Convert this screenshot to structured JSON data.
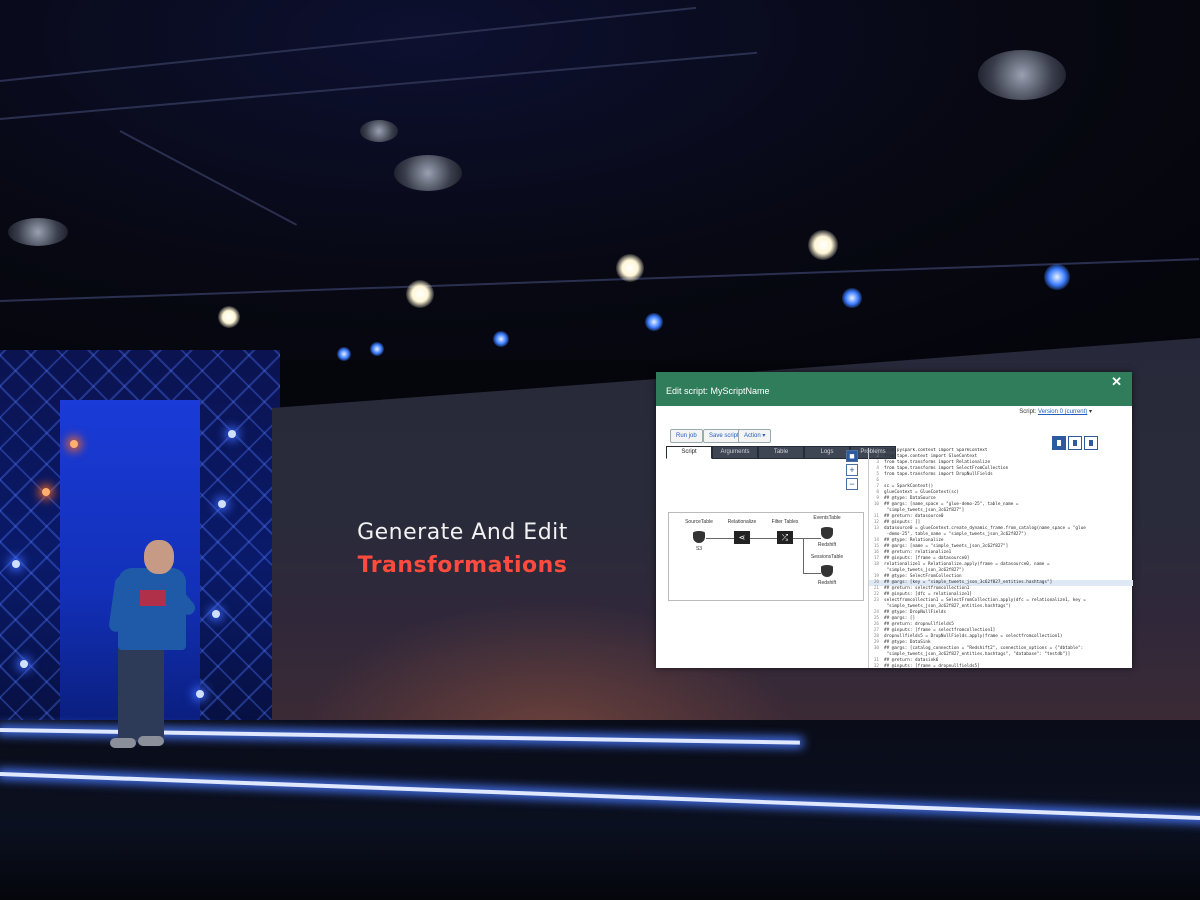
{
  "slide": {
    "line1": "Generate And Edit",
    "line2": "Transformations",
    "line2_color": "#ff4b3e"
  },
  "console": {
    "title": "Edit script: MyScriptName",
    "close_icon": "close-icon",
    "script_label": "Script:",
    "script_version": "Version 0 (current)",
    "buttons": {
      "run": "Run job",
      "save": "Save script",
      "action": "Action ▾"
    },
    "tabs": [
      "Script",
      "Arguments",
      "Table",
      "Logs",
      "Problems"
    ],
    "active_tab": "Script",
    "title_bar_color": "#2f7d5a",
    "graph": {
      "nodes": [
        "SourceTable",
        "Relationalize",
        "Filter Tables",
        "EventsTable",
        "SessionsTable"
      ],
      "db_labels": [
        "S3",
        "Redshift",
        "Redshift"
      ]
    },
    "code_lines": [
      {
        "n": "1",
        "t": "from pyspark.context import SparkContext"
      },
      {
        "n": "2",
        "t": "from tape.context import GlueContext"
      },
      {
        "n": "3",
        "t": "from tape.transforms import Relationalize"
      },
      {
        "n": "4",
        "t": "from tape.transforms import SelectFromCollection"
      },
      {
        "n": "5",
        "t": "from tape.transforms import DropNullFields"
      },
      {
        "n": "6",
        "t": ""
      },
      {
        "n": "7",
        "t": "sc = SparkContext()"
      },
      {
        "n": "8",
        "t": "glueContext = GlueContext(sc)"
      },
      {
        "n": "9",
        "t": "## @type: DataSource"
      },
      {
        "n": "10",
        "t": "## @args: [name_space = \"glue-demo-25\", table_name ="
      },
      {
        "n": "",
        "t": "    \"simple_tweets_json_3c62f827\"]"
      },
      {
        "n": "11",
        "t": "## @return: datasource0"
      },
      {
        "n": "12",
        "t": "## @inputs: []"
      },
      {
        "n": "13",
        "t": "datasource0 = glueContext.create_dynamic_frame.from_catalog(name_space = \"glue"
      },
      {
        "n": "",
        "t": "    -demo-25\", table_name = \"simple_tweets_json_3c62f827\")"
      },
      {
        "n": "14",
        "t": "## @type: Relationalize"
      },
      {
        "n": "15",
        "t": "## @args: [name = \"simple_tweets_json_3c62f827\"]"
      },
      {
        "n": "16",
        "t": "## @return: relationalize1"
      },
      {
        "n": "17",
        "t": "## @inputs: [frame = datasource0]"
      },
      {
        "n": "18",
        "t": "relationalize1 = Relationalize.apply(frame = datasource0, name ="
      },
      {
        "n": "",
        "t": "    \"simple_tweets_json_3c62f827\")"
      },
      {
        "n": "19",
        "t": "## @type: SelectFromCollection"
      },
      {
        "n": "20",
        "t": "## @args: [key = \"simple_tweets_json_3c62f827_entities.hashtags\"]"
      },
      {
        "n": "21",
        "t": "## @return: selectfromcollection1"
      },
      {
        "n": "22",
        "t": "## @inputs: [dfc = relationalize1]"
      },
      {
        "n": "23",
        "t": "selectfromcollection1 = SelectFromCollection.apply(dfc = relationalize1, key ="
      },
      {
        "n": "",
        "t": "    \"simple_tweets_json_3c62f827_entities.hashtags\")"
      },
      {
        "n": "24",
        "t": "## @type: DropNullFields"
      },
      {
        "n": "25",
        "t": "## @args: []"
      },
      {
        "n": "26",
        "t": "## @return: dropnullfields5"
      },
      {
        "n": "27",
        "t": "## @inputs: [frame = selectfromcollection1]"
      },
      {
        "n": "28",
        "t": "dropnullfields5 = DropNullFields.apply(frame = selectfromcollection1)"
      },
      {
        "n": "29",
        "t": "## @type: DataSink"
      },
      {
        "n": "30",
        "t": "## @args: [catalog_connection = \"Redshift2\", connection_options = {\"dbtable\":"
      },
      {
        "n": "",
        "t": "    \"simple_tweets_json_3c62f827_entities.hashtags\", \"database\": \"testdb\"}]"
      },
      {
        "n": "31",
        "t": "## @return: datasink6"
      },
      {
        "n": "32",
        "t": "## @inputs: [frame = dropnullfields5]"
      },
      {
        "n": "33",
        "t": "datasink6 = glueContext.write_dynamic_frame.from_jdbc_conf(frame ="
      }
    ],
    "highlight_line": "20"
  }
}
